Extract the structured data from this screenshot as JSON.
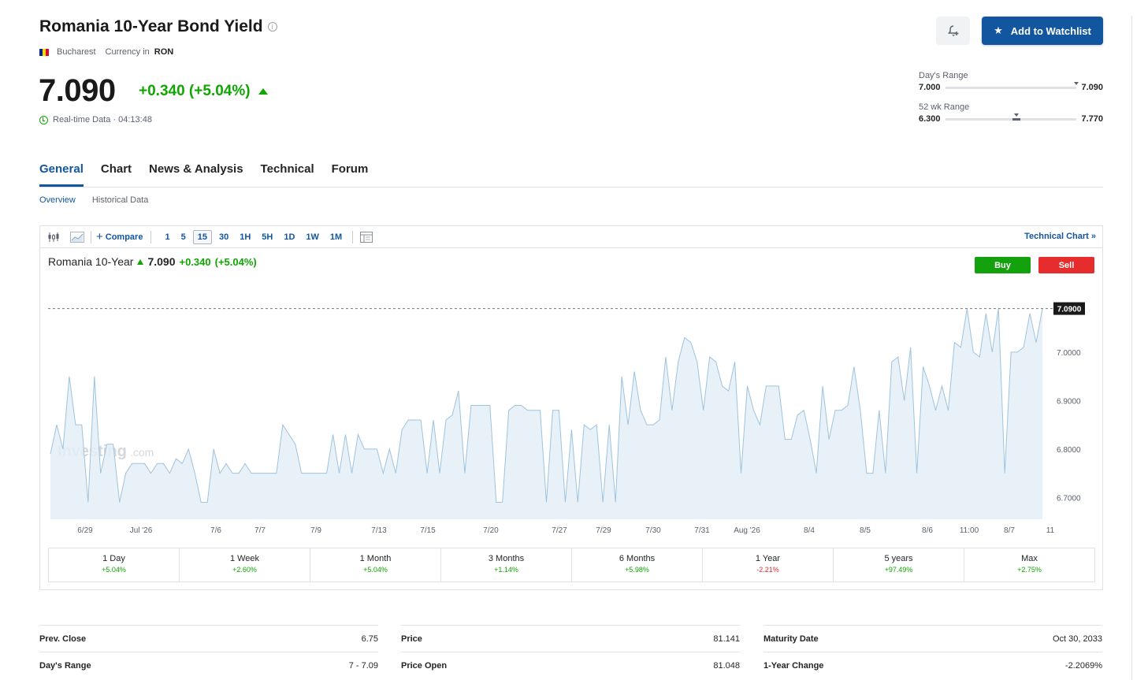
{
  "header": {
    "title": "Romania 10-Year Bond Yield",
    "exchange": "Bucharest",
    "currency_label": "Currency in",
    "currency": "RON",
    "price": "7.090",
    "change": "+0.340 (+5.04%)",
    "realtime": "Real-time Data · 04:13:48",
    "watchlist_label": "Add to Watchlist"
  },
  "ranges": {
    "day": {
      "label": "Day's Range",
      "low": "7.000",
      "high": "7.090",
      "position": 1.0
    },
    "week52": {
      "label": "52 wk Range",
      "low": "6.300",
      "high": "7.770",
      "position": 0.54
    }
  },
  "tabs": [
    "General",
    "Chart",
    "News & Analysis",
    "Technical",
    "Forum"
  ],
  "subtabs": [
    "Overview",
    "Historical Data"
  ],
  "toolbar": {
    "compare": "Compare",
    "intervals": [
      "1",
      "5",
      "15",
      "30",
      "1H",
      "5H",
      "1D",
      "1W",
      "1M"
    ],
    "selected_interval": "15",
    "technical_chart": "Technical Chart »"
  },
  "chart_header": {
    "name": "Romania 10-Year",
    "price": "7.090",
    "change": "+0.340",
    "pct": "(+5.04%)",
    "buy": "Buy",
    "sell": "Sell",
    "watermark": "Investing",
    "watermark_suffix": ".com",
    "last_label": "7.0900"
  },
  "chart_data": {
    "type": "area",
    "x_tick_labels": [
      "6/29",
      "Jul '26",
      "7/6",
      "7/7",
      "7/9",
      "7/13",
      "7/15",
      "7/20",
      "7/27",
      "7/29",
      "7/30",
      "7/31",
      "Aug '26",
      "8/4",
      "8/5",
      "8/6",
      "11:00",
      "8/7",
      "11"
    ],
    "y_ticks": [
      "7.0000",
      "6.9000",
      "6.8000",
      "6.7000"
    ],
    "ylim": [
      6.655,
      7.13
    ],
    "last_value": 7.09,
    "values": [
      6.79,
      6.85,
      6.8,
      6.95,
      6.85,
      6.85,
      6.69,
      6.95,
      6.75,
      6.81,
      6.81,
      6.69,
      6.75,
      6.77,
      6.77,
      6.77,
      6.75,
      6.77,
      6.77,
      6.75,
      6.78,
      6.77,
      6.8,
      6.75,
      6.69,
      6.69,
      6.8,
      6.75,
      6.77,
      6.75,
      6.75,
      6.77,
      6.75,
      6.75,
      6.75,
      6.75,
      6.75,
      6.85,
      6.83,
      6.81,
      6.75,
      6.75,
      6.75,
      6.75,
      6.75,
      6.83,
      6.75,
      6.83,
      6.75,
      6.83,
      6.8,
      6.8,
      6.8,
      6.75,
      6.8,
      6.75,
      6.84,
      6.86,
      6.86,
      6.86,
      6.75,
      6.86,
      6.75,
      6.86,
      6.87,
      6.92,
      6.75,
      6.89,
      6.89,
      6.89,
      6.89,
      6.69,
      6.69,
      6.88,
      6.89,
      6.89,
      6.88,
      6.88,
      6.88,
      6.69,
      6.88,
      6.88,
      6.69,
      6.84,
      6.69,
      6.85,
      6.84,
      6.85,
      6.69,
      6.85,
      6.69,
      6.95,
      6.85,
      6.96,
      6.88,
      6.85,
      6.85,
      6.86,
      6.99,
      6.88,
      6.98,
      7.03,
      7.02,
      6.98,
      6.88,
      6.99,
      6.98,
      6.93,
      6.92,
      6.98,
      6.75,
      6.93,
      6.88,
      6.85,
      6.93,
      6.93,
      6.93,
      6.82,
      6.82,
      6.87,
      6.88,
      6.82,
      6.75,
      6.93,
      6.82,
      6.88,
      6.88,
      6.89,
      6.97,
      6.88,
      6.75,
      6.75,
      6.88,
      6.75,
      6.98,
      6.99,
      6.9,
      7.01,
      6.75,
      6.97,
      6.93,
      6.88,
      6.93,
      6.88,
      7.02,
      7.01,
      7.09,
      7.0,
      6.99,
      7.08,
      7.0,
      7.09,
      6.75,
      7.0,
      7.0,
      7.01,
      7.08,
      7.02,
      7.09
    ]
  },
  "performance": [
    {
      "label": "1 Day",
      "value": "+5.04%",
      "negative": false
    },
    {
      "label": "1 Week",
      "value": "+2.60%",
      "negative": false
    },
    {
      "label": "1 Month",
      "value": "+5.04%",
      "negative": false
    },
    {
      "label": "3 Months",
      "value": "+1.14%",
      "negative": false
    },
    {
      "label": "6 Months",
      "value": "+5.98%",
      "negative": false
    },
    {
      "label": "1 Year",
      "value": "-2.21%",
      "negative": true
    },
    {
      "label": "5 years",
      "value": "+97.49%",
      "negative": false
    },
    {
      "label": "Max",
      "value": "+2.75%",
      "negative": false
    }
  ],
  "stats": [
    [
      {
        "k": "Prev. Close",
        "v": "6.75"
      },
      {
        "k": "Day's Range",
        "v": "7 - 7.09"
      }
    ],
    [
      {
        "k": "Price",
        "v": "81.141"
      },
      {
        "k": "Price Open",
        "v": "81.048"
      }
    ],
    [
      {
        "k": "Maturity Date",
        "v": "Oct 30, 2033"
      },
      {
        "k": "1-Year Change",
        "v": "-2.2069%"
      }
    ]
  ],
  "colors": {
    "accent": "#1256a0",
    "up": "#0ea600",
    "down": "#e62c2c",
    "line": "#9ec3de",
    "fill": "#e4eef7"
  }
}
